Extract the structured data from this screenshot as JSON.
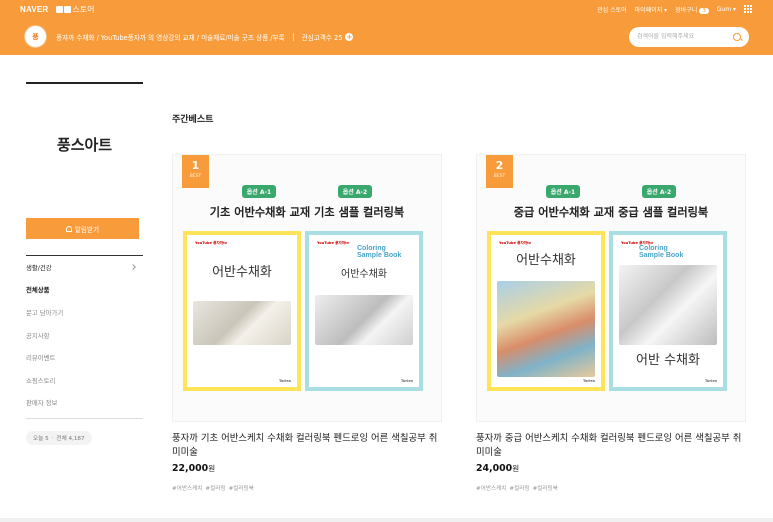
{
  "topbar": {
    "naver": "NAVER",
    "store": "스토어",
    "links": [
      "관심 스토어",
      "마이페이지",
      "장바구니"
    ],
    "cart_count": "3",
    "user": "Gum"
  },
  "store": {
    "avatar_text": "풍",
    "title": "풍자까 수채화 / YouTube풍자까 의 영상강의 교재 / 미술재료/미술 굿즈 상품 /부록",
    "interest_label": "관심고객수 25",
    "search_placeholder": "검색어를 입력해주세요"
  },
  "sidebar": {
    "store_name": "풍스아트",
    "alarm_button": "알림받기",
    "menu": [
      {
        "label": "생활/건강",
        "has_arrow": true
      },
      {
        "label": "전체상품",
        "active": true
      },
      {
        "label": "문고 담아가기"
      },
      {
        "label": "공지사항"
      },
      {
        "label": "리뷰이벤트"
      },
      {
        "label": "쇼핑스토리"
      },
      {
        "label": "판매자 정보"
      }
    ],
    "visitors_today": "오늘 5",
    "visitors_total": "전체 4,187"
  },
  "main": {
    "section_title": "주간베스트",
    "products": [
      {
        "rank": "1",
        "rank_label": "BEST",
        "opt1": "옵션 A-1",
        "opt2": "옵션 A-2",
        "heading": "기초 어반수채화 교재  기초 샘플 컬러링북",
        "book1_title": "어반수채화",
        "book2_title": "어반수채화",
        "name": "풍자까 기초 어반스케치 수채화 컬러링북 펜드로잉 어른 색칠공부 취미미술",
        "price": "22,000",
        "currency": "원",
        "tags": [
          "#어반스케치",
          "#컬러링",
          "#컬러링북"
        ]
      },
      {
        "rank": "2",
        "rank_label": "BEST",
        "opt1": "옵션 A-1",
        "opt2": "옵션 A-2",
        "heading": "중급 어반수채화 교재  중급 샘플 컬러링북",
        "book1_title": "어반수채화",
        "book2_title": "어반 수채화",
        "name": "풍자까 중급 어반스케치 수채화 컬러링북 펜드로잉 어른 색칠공부 취미미술",
        "price": "24,000",
        "currency": "원",
        "tags": [
          "#어반스케치",
          "#컬러링",
          "#컬러링북"
        ]
      }
    ],
    "book_labels": {
      "youtube": "YouTube 풍자까tv",
      "coloring_line1": "Coloring",
      "coloring_line2": "Sample Book",
      "publisher": "Tories"
    }
  },
  "colors": {
    "brand": "#f89c3b",
    "option_green": "#3aa76d",
    "book_yellow": "#ffe45a",
    "book_cyan": "#a9dfe3"
  }
}
